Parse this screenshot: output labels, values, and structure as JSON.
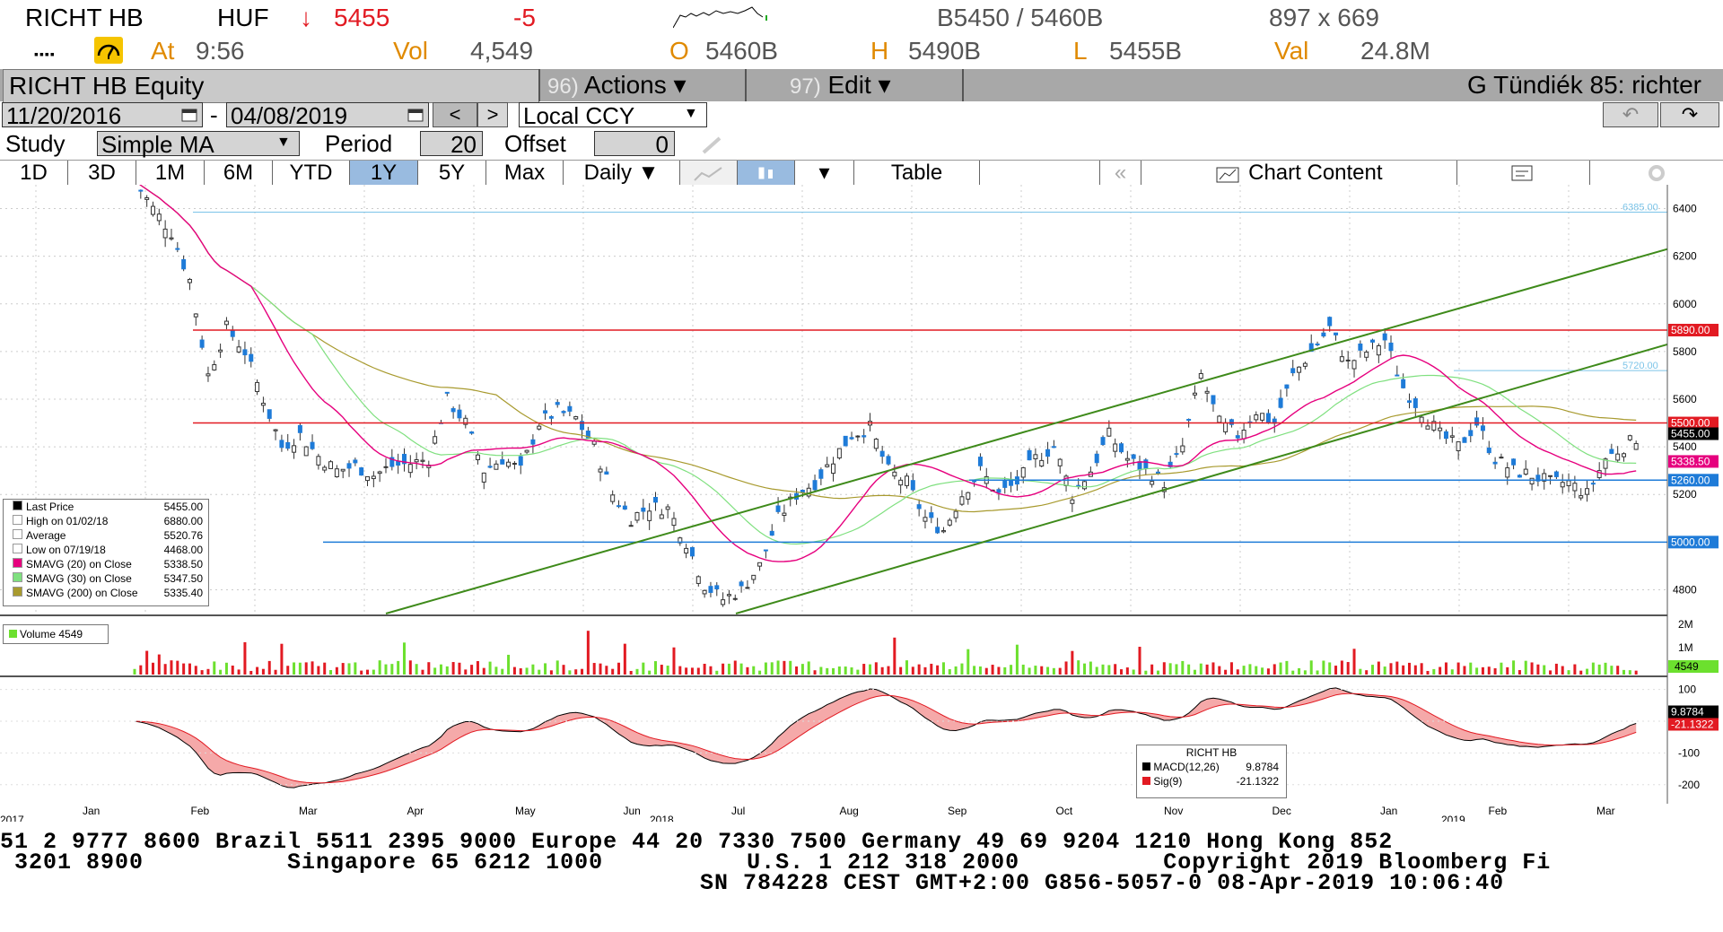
{
  "quote": {
    "ticker": "RICHT HB",
    "currency": "HUF",
    "arrow": "↓",
    "last": "5455",
    "change": "-5",
    "bid_ask": "B5450 / 5460B",
    "size": "897 x 669",
    "dots": "▪▪▪▪",
    "at_label": "At",
    "time": "9:56",
    "vol_label": "Vol",
    "vol": "4,549",
    "open_label": "O",
    "open": "5460B",
    "high_label": "H",
    "high": "5490B",
    "low_label": "L",
    "low": "5455B",
    "val_label": "Val",
    "val": "24.8M"
  },
  "menubar": {
    "title": "RICHT HB Equity",
    "actions_num": "96)",
    "actions_label": "Actions ▾",
    "edit_num": "97)",
    "edit_label": "Edit ▾",
    "right_label": "G Tündiék 85: richter"
  },
  "controls": {
    "date_from": "11/20/2016",
    "date_sep": "-",
    "date_to": "04/08/2019",
    "prev": "<",
    "next": ">",
    "ccy": "Local CCY",
    "undo_icon": "↶",
    "redo_icon": "↷",
    "study_label": "Study",
    "study_value": "Simple MA",
    "period_label": "Period",
    "period_value": "20",
    "offset_label": "Offset",
    "offset_value": "0"
  },
  "tabs": {
    "items": [
      {
        "label": "1D"
      },
      {
        "label": "3D"
      },
      {
        "label": "1M"
      },
      {
        "label": "6M"
      },
      {
        "label": "YTD"
      },
      {
        "label": "1Y"
      },
      {
        "label": "5Y"
      },
      {
        "label": "Max"
      }
    ],
    "interval": "Daily ▼",
    "dropdown": "▾",
    "table": "Table",
    "collapse": "«",
    "chart_content": "Chart Content",
    "accent": "#99bbe0"
  },
  "legend": {
    "rows": [
      {
        "label": "Last Price",
        "value": "5455.00",
        "color": "#000000"
      },
      {
        "label": "High on 01/02/18",
        "value": "6880.00",
        "color": "#ffffff"
      },
      {
        "label": "Average",
        "value": "5520.76",
        "color": "#ffffff"
      },
      {
        "label": "Low on 07/19/18",
        "value": "4468.00",
        "color": "#ffffff"
      },
      {
        "label": "SMAVG (20)  on Close",
        "value": "5338.50",
        "color": "#e6007e"
      },
      {
        "label": "SMAVG (30)  on Close",
        "value": "5347.50",
        "color": "#7fe07f"
      },
      {
        "label": "SMAVG (200)  on Close",
        "value": "5335.40",
        "color": "#a89a2e"
      }
    ]
  },
  "volume_legend": "Volume 4549",
  "macd_legend": {
    "title": "RICHT HB",
    "macd_label": "MACD(12,26)",
    "macd_value": "9.8784",
    "sig_label": "Sig(9)",
    "sig_value": "-21.1322"
  },
  "ticker": {
    "line1": "51 2 9777 8600 Brazil 5511 2395 9000 Europe 44 20 7330 7500 Germany 49 69 9204 1210 Hong Kong 852",
    "line2": " 3201 8900          Singapore 65 6212 1000          U.S. 1 212 318 2000          Copyright 2019 Bloomberg Fi",
    "line3": "SN 784228 CEST GMT+2:00 G856-5057-0 08-Apr-2019 10:06:40"
  },
  "chart_data": {
    "type": "candlestick",
    "price_axis": {
      "ticks": [
        "6400",
        "6200",
        "6000",
        "5800",
        "5600",
        "5400",
        "5200",
        "4800"
      ],
      "ylim": [
        4700,
        6500
      ]
    },
    "right_labels": [
      {
        "text": "5890.00",
        "value": 5890,
        "color": "#e21a22"
      },
      {
        "text": "5500.00",
        "value": 5500,
        "color": "#e21a22"
      },
      {
        "text": "5455.00",
        "value": 5455,
        "color": "#000000"
      },
      {
        "text": "5338.50",
        "value": 5338.5,
        "color": "#e6007e"
      },
      {
        "text": "5260.00",
        "value": 5260,
        "color": "#1e7bd8"
      },
      {
        "text": "5000.00",
        "value": 5000,
        "color": "#1e7bd8"
      }
    ],
    "line_labels": [
      {
        "text": "6385.00",
        "value": 6385
      },
      {
        "text": "5720.00",
        "value": 5720
      }
    ],
    "volume_axis": {
      "ticks": [
        "2M",
        "1M"
      ],
      "last": "4549"
    },
    "macd_axis": {
      "ticks": [
        "100",
        "0",
        "-100",
        "-200"
      ],
      "ylim": [
        -260,
        130
      ],
      "macd_last": "9.8784",
      "sig_last": "-21.1322"
    },
    "x_months": [
      "Jan",
      "Feb",
      "Mar",
      "Apr",
      "May",
      "Jun",
      "Jul",
      "Aug",
      "Sep",
      "Oct",
      "Nov",
      "Dec",
      "Jan",
      "Feb",
      "Mar"
    ],
    "x_years": [
      "2017",
      "2018",
      "2019"
    ],
    "close_path": [
      [
        0,
        6520
      ],
      [
        3,
        6400
      ],
      [
        6,
        6300
      ],
      [
        9,
        6100
      ],
      [
        12,
        5700
      ],
      [
        15,
        5900
      ],
      [
        18,
        5800
      ],
      [
        21,
        5600
      ],
      [
        24,
        5400
      ],
      [
        27,
        5450
      ],
      [
        30,
        5360
      ],
      [
        33,
        5300
      ],
      [
        36,
        5320
      ],
      [
        39,
        5280
      ],
      [
        42,
        5320
      ],
      [
        45,
        5330
      ],
      [
        48,
        5350
      ],
      [
        51,
        5600
      ],
      [
        54,
        5500
      ],
      [
        57,
        5300
      ],
      [
        60,
        5350
      ],
      [
        63,
        5300
      ],
      [
        66,
        5500
      ],
      [
        69,
        5550
      ],
      [
        72,
        5520
      ],
      [
        75,
        5400
      ],
      [
        78,
        5200
      ],
      [
        81,
        5100
      ],
      [
        84,
        5150
      ],
      [
        87,
        5140
      ],
      [
        90,
        5000
      ],
      [
        93,
        4820
      ],
      [
        96,
        4760
      ],
      [
        99,
        4800
      ],
      [
        102,
        4900
      ],
      [
        105,
        5100
      ],
      [
        108,
        5200
      ],
      [
        111,
        5250
      ],
      [
        114,
        5350
      ],
      [
        117,
        5450
      ],
      [
        120,
        5480
      ],
      [
        123,
        5300
      ],
      [
        126,
        5250
      ],
      [
        129,
        5100
      ],
      [
        132,
        5050
      ],
      [
        135,
        5200
      ],
      [
        138,
        5300
      ],
      [
        141,
        5200
      ],
      [
        144,
        5250
      ],
      [
        147,
        5350
      ],
      [
        150,
        5400
      ],
      [
        153,
        5200
      ],
      [
        156,
        5300
      ],
      [
        159,
        5450
      ],
      [
        162,
        5350
      ],
      [
        165,
        5300
      ],
      [
        168,
        5250
      ],
      [
        171,
        5400
      ],
      [
        174,
        5700
      ],
      [
        177,
        5500
      ],
      [
        180,
        5450
      ],
      [
        183,
        5550
      ],
      [
        186,
        5500
      ],
      [
        189,
        5700
      ],
      [
        192,
        5800
      ],
      [
        195,
        5900
      ],
      [
        198,
        5750
      ],
      [
        201,
        5800
      ],
      [
        204,
        5850
      ],
      [
        207,
        5650
      ],
      [
        210,
        5550
      ],
      [
        213,
        5450
      ],
      [
        216,
        5400
      ],
      [
        219,
        5500
      ],
      [
        222,
        5350
      ],
      [
        225,
        5300
      ],
      [
        228,
        5280
      ],
      [
        231,
        5250
      ],
      [
        234,
        5250
      ],
      [
        237,
        5200
      ],
      [
        240,
        5350
      ],
      [
        243,
        5400
      ],
      [
        246,
        5455
      ]
    ]
  }
}
